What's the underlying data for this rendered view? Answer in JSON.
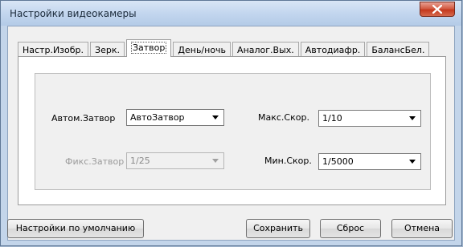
{
  "window": {
    "title": "Настройки видеокамеры",
    "close_icon": "close-x-icon"
  },
  "tabs": [
    {
      "label": "Настр.Изобр.",
      "active": false
    },
    {
      "label": "Зерк.",
      "active": false
    },
    {
      "label": "Затвор",
      "active": true
    },
    {
      "label": "День/ночь",
      "active": false
    },
    {
      "label": "Аналог.Вых.",
      "active": false
    },
    {
      "label": "Автодиафр.",
      "active": false
    },
    {
      "label": "БалансБел.",
      "active": false
    }
  ],
  "shutter": {
    "auto_shutter": {
      "label": "Автом.Затвор",
      "value": "АвтоЗатвор",
      "enabled": true
    },
    "fixed_shutter": {
      "label": "Фикс.Затвор",
      "value": "1/25",
      "enabled": false
    },
    "max_speed": {
      "label": "Макс.Скор.",
      "value": "1/10",
      "enabled": true
    },
    "min_speed": {
      "label": "Мин.Скор.",
      "value": "1/5000",
      "enabled": true
    }
  },
  "buttons": {
    "defaults": "Настройки по умолчанию",
    "save": "Сохранить",
    "reset": "Сброс",
    "cancel": "Отмена"
  }
}
